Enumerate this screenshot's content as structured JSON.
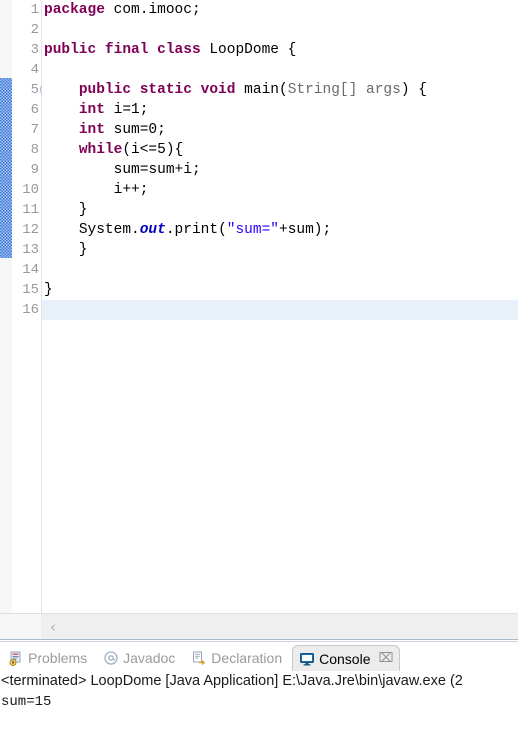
{
  "editor": {
    "gutter": [
      {
        "number": "1",
        "fold": false
      },
      {
        "number": "2",
        "fold": false
      },
      {
        "number": "3",
        "fold": false
      },
      {
        "number": "4",
        "fold": false
      },
      {
        "number": "5",
        "fold": true
      },
      {
        "number": "6",
        "fold": false
      },
      {
        "number": "7",
        "fold": false
      },
      {
        "number": "8",
        "fold": false
      },
      {
        "number": "9",
        "fold": false
      },
      {
        "number": "10",
        "fold": false
      },
      {
        "number": "11",
        "fold": false
      },
      {
        "number": "12",
        "fold": false
      },
      {
        "number": "13",
        "fold": false
      },
      {
        "number": "14",
        "fold": false
      },
      {
        "number": "15",
        "fold": false
      },
      {
        "number": "16",
        "fold": false
      }
    ],
    "lines": [
      {
        "n": 1,
        "text": "package com.imooc;"
      },
      {
        "n": 2,
        "text": ""
      },
      {
        "n": 3,
        "text": "public final class LoopDome {"
      },
      {
        "n": 4,
        "text": ""
      },
      {
        "n": 5,
        "text": "    public static void main(String[] args) {"
      },
      {
        "n": 6,
        "text": "    int i=1;"
      },
      {
        "n": 7,
        "text": "    int sum=0;"
      },
      {
        "n": 8,
        "text": "    while(i<=5){"
      },
      {
        "n": 9,
        "text": "        sum=sum+i;"
      },
      {
        "n": 10,
        "text": "        i++;"
      },
      {
        "n": 11,
        "text": "    }"
      },
      {
        "n": 12,
        "text": "    System.out.print(\"sum=\"+sum);"
      },
      {
        "n": 13,
        "text": "    }"
      },
      {
        "n": 14,
        "text": ""
      },
      {
        "n": 15,
        "text": "}"
      },
      {
        "n": 16,
        "text": ""
      }
    ],
    "current_line": 16,
    "language": "java",
    "colors": {
      "keyword": "#7f0055",
      "string": "#2a00ff",
      "static_field": "#0000c0",
      "parameter": "#6a6a6a",
      "current_line_highlight": "#e8f0fa",
      "change_marker": "#3b7ad9"
    },
    "scrollbar": {
      "left_arrow_glyph": "‹"
    }
  },
  "bottom_panel": {
    "tabs": [
      {
        "label": "Problems",
        "icon": "problems-icon",
        "active": false,
        "closable": false
      },
      {
        "label": "Javadoc",
        "icon": "javadoc-icon",
        "active": false,
        "closable": false
      },
      {
        "label": "Declaration",
        "icon": "declaration-icon",
        "active": false,
        "closable": false
      },
      {
        "label": "Console",
        "icon": "console-icon",
        "active": true,
        "closable": true,
        "close_glyph": "⌧"
      }
    ],
    "console": {
      "status_line": "<terminated> LoopDome [Java Application] E:\\Java.Jre\\bin\\javaw.exe (2",
      "output_lines": [
        "sum=15"
      ]
    }
  }
}
